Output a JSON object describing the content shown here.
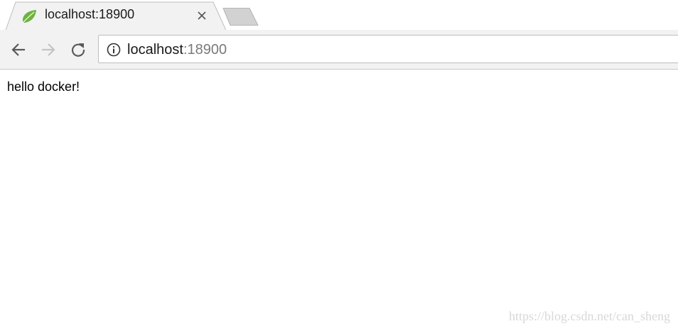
{
  "window": {
    "tab": {
      "title": "localhost:18900",
      "favicon": "spring-leaf-icon",
      "close_icon": "close-icon",
      "active": true
    },
    "new_tab_icon": "new-tab-icon"
  },
  "toolbar": {
    "back_icon": "arrow-left-icon",
    "forward_icon": "arrow-right-icon",
    "forward_enabled": false,
    "reload_icon": "reload-icon",
    "omnibox": {
      "info_icon": "info-icon",
      "host": "localhost",
      "port": ":18900"
    }
  },
  "page": {
    "body_text": "hello docker!"
  },
  "watermark": "https://blog.csdn.net/can_sheng",
  "colors": {
    "favicon_green": "#6db33f",
    "toolbar_bg": "#f2f2f2",
    "url_secondary": "#7a7a7a"
  }
}
